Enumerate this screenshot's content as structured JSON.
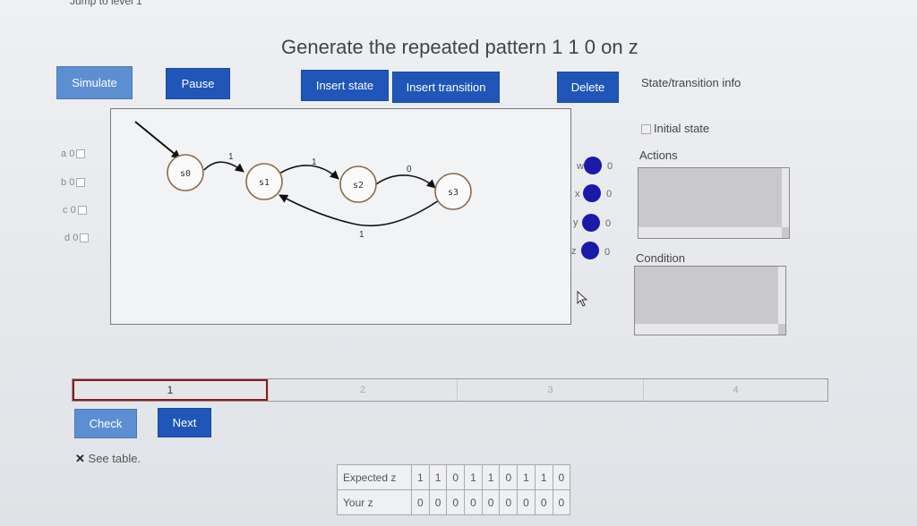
{
  "jump_link": "Jump to level 1",
  "title": "Generate the repeated pattern 1 1 0 on z",
  "buttons": {
    "simulate": "Simulate",
    "pause": "Pause",
    "insert_state": "Insert state",
    "insert_transition": "Insert transition",
    "delete": "Delete"
  },
  "state_transition_info": "State/transition info",
  "initial_state_label": "Initial state",
  "actions_label": "Actions",
  "condition_label": "Condition",
  "inputs": [
    {
      "name": "a",
      "value": "0"
    },
    {
      "name": "b",
      "value": "0"
    },
    {
      "name": "c",
      "value": "0"
    },
    {
      "name": "d",
      "value": "0"
    }
  ],
  "outputs": [
    {
      "name": "w",
      "value": "0"
    },
    {
      "name": "x",
      "value": "0"
    },
    {
      "name": "y",
      "value": "0"
    },
    {
      "name": "z",
      "value": "0"
    }
  ],
  "diagram": {
    "states": [
      "s0",
      "s1",
      "s2",
      "s3"
    ],
    "transition_labels": [
      "1",
      "1",
      "0",
      "1"
    ]
  },
  "progress": {
    "steps": [
      "1",
      "2",
      "3",
      "4"
    ],
    "current": 1
  },
  "check_label": "Check",
  "next_label": "Next",
  "see_table": "See table.",
  "table": {
    "rows": [
      {
        "label": "Expected z",
        "values": [
          "1",
          "1",
          "0",
          "1",
          "1",
          "0",
          "1",
          "1",
          "0"
        ]
      },
      {
        "label": "Your z",
        "values": [
          "0",
          "0",
          "0",
          "0",
          "0",
          "0",
          "0",
          "0",
          "0"
        ]
      }
    ]
  },
  "colors": {
    "button_light": "#5b8fd1",
    "button_dark": "#1f56b8",
    "output_dot": "#1a1aa8",
    "active_step_border": "#8b1a1a"
  }
}
